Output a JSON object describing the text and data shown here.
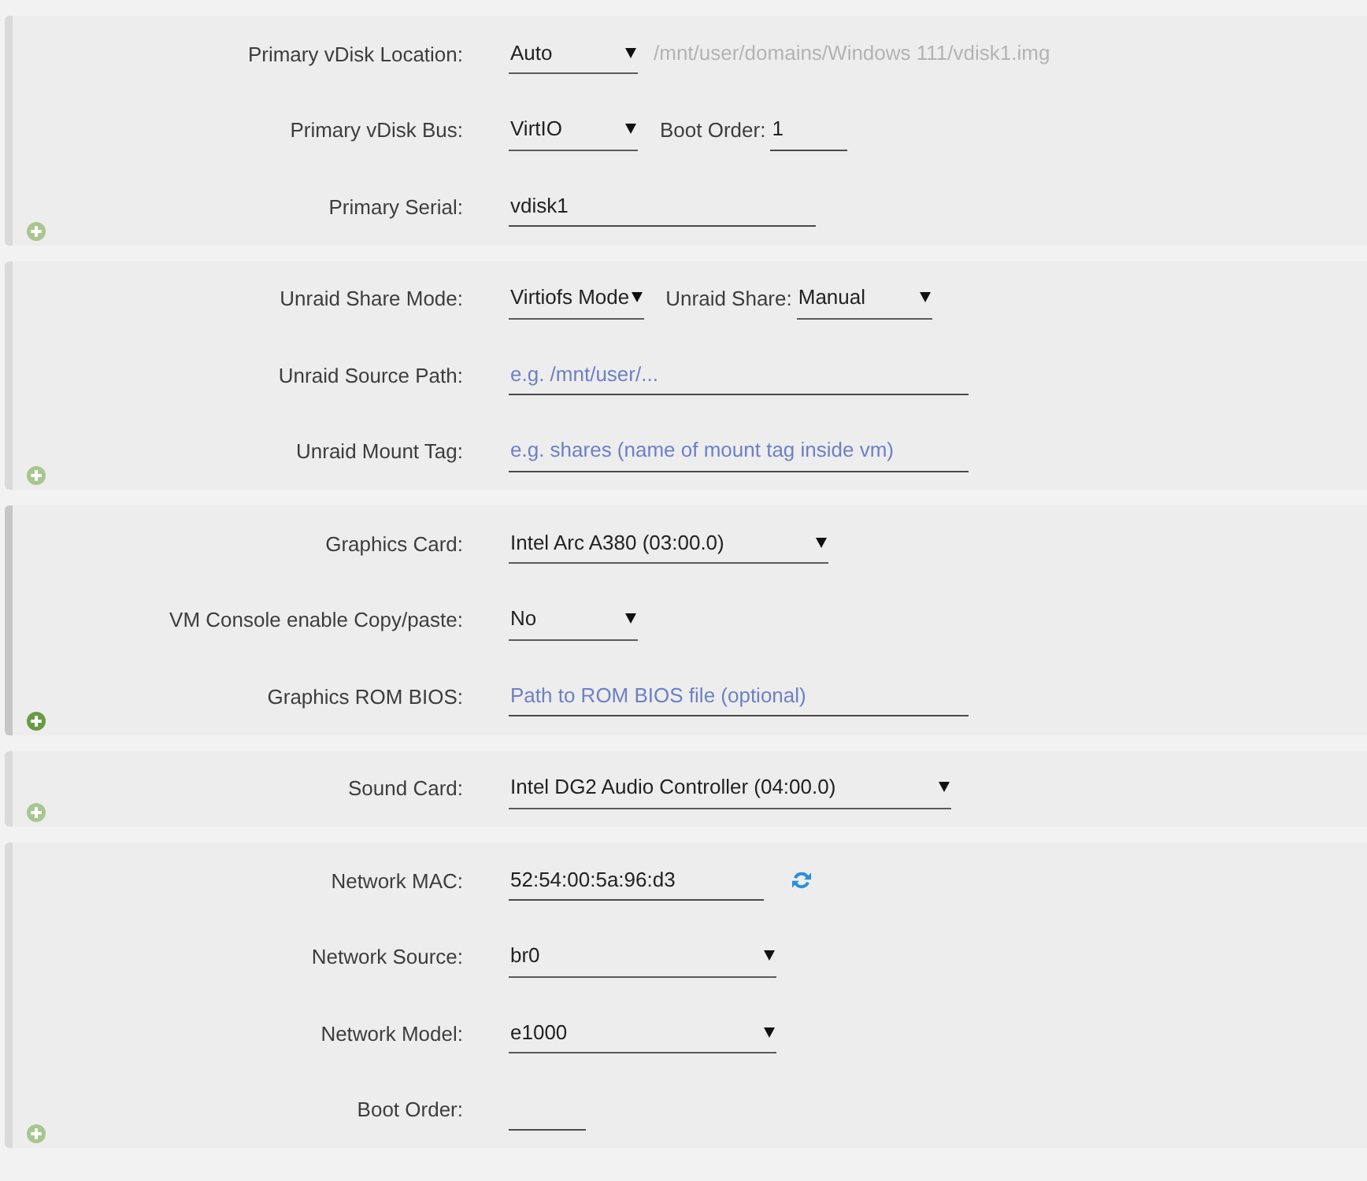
{
  "sections": [
    {
      "hovered": false,
      "rows": [
        {
          "label": "Primary vDisk Location:",
          "fields": [
            {
              "kind": "select",
              "value": "Auto",
              "disabled": false
            },
            {
              "kind": "input",
              "value": "/mnt/user/domains/Windows 111/vdisk1.img",
              "disabled": true
            }
          ]
        },
        {
          "label": "Primary vDisk Bus:",
          "fields": [
            {
              "kind": "select",
              "value": "VirtIO",
              "disabled": false
            },
            {
              "kind": "label",
              "text": "Boot Order:"
            },
            {
              "kind": "input",
              "value": "1",
              "disabled": false
            }
          ]
        },
        {
          "label": "Primary Serial:",
          "fields": [
            {
              "kind": "input",
              "value": "vdisk1",
              "disabled": false
            }
          ]
        }
      ]
    },
    {
      "hovered": false,
      "rows": [
        {
          "label": "Unraid Share Mode:",
          "fields": [
            {
              "kind": "select",
              "value": "Virtiofs Mode",
              "disabled": false
            },
            {
              "kind": "label",
              "text": "Unraid Share:"
            },
            {
              "kind": "select",
              "value": "Manual",
              "disabled": false
            }
          ]
        },
        {
          "label": "Unraid Source Path:",
          "fields": [
            {
              "kind": "input",
              "placeholder": "e.g. /mnt/user/...",
              "disabled": false
            }
          ]
        },
        {
          "label": "Unraid Mount Tag:",
          "fields": [
            {
              "kind": "input",
              "placeholder": "e.g. shares (name of mount tag inside vm)",
              "disabled": false
            }
          ]
        }
      ]
    },
    {
      "hovered": true,
      "rows": [
        {
          "label": "Graphics Card:",
          "fields": [
            {
              "kind": "select",
              "value": "Intel Arc A380 (03:00.0)",
              "disabled": false
            }
          ]
        },
        {
          "label": "VM Console enable Copy/paste:",
          "fields": [
            {
              "kind": "select",
              "value": "No",
              "disabled": false
            }
          ]
        },
        {
          "label": "Graphics ROM BIOS:",
          "fields": [
            {
              "kind": "input",
              "placeholder": "Path to ROM BIOS file (optional)",
              "disabled": false
            }
          ]
        }
      ]
    },
    {
      "hovered": false,
      "rows": [
        {
          "label": "Sound Card:",
          "fields": [
            {
              "kind": "select",
              "value": "Intel DG2 Audio Controller (04:00.0)",
              "disabled": false
            }
          ]
        }
      ]
    },
    {
      "hovered": false,
      "rows": [
        {
          "label": "Network MAC:",
          "fields": [
            {
              "kind": "input",
              "value": "52:54:00:5a:96:d3",
              "disabled": false
            },
            {
              "kind": "refresh"
            }
          ]
        },
        {
          "label": "Network Source:",
          "fields": [
            {
              "kind": "select",
              "value": "br0",
              "disabled": false
            }
          ]
        },
        {
          "label": "Network Model:",
          "fields": [
            {
              "kind": "select",
              "value": "e1000",
              "disabled": false
            }
          ]
        },
        {
          "label": "Boot Order:",
          "fields": [
            {
              "kind": "input",
              "disabled": false
            }
          ]
        }
      ]
    }
  ]
}
